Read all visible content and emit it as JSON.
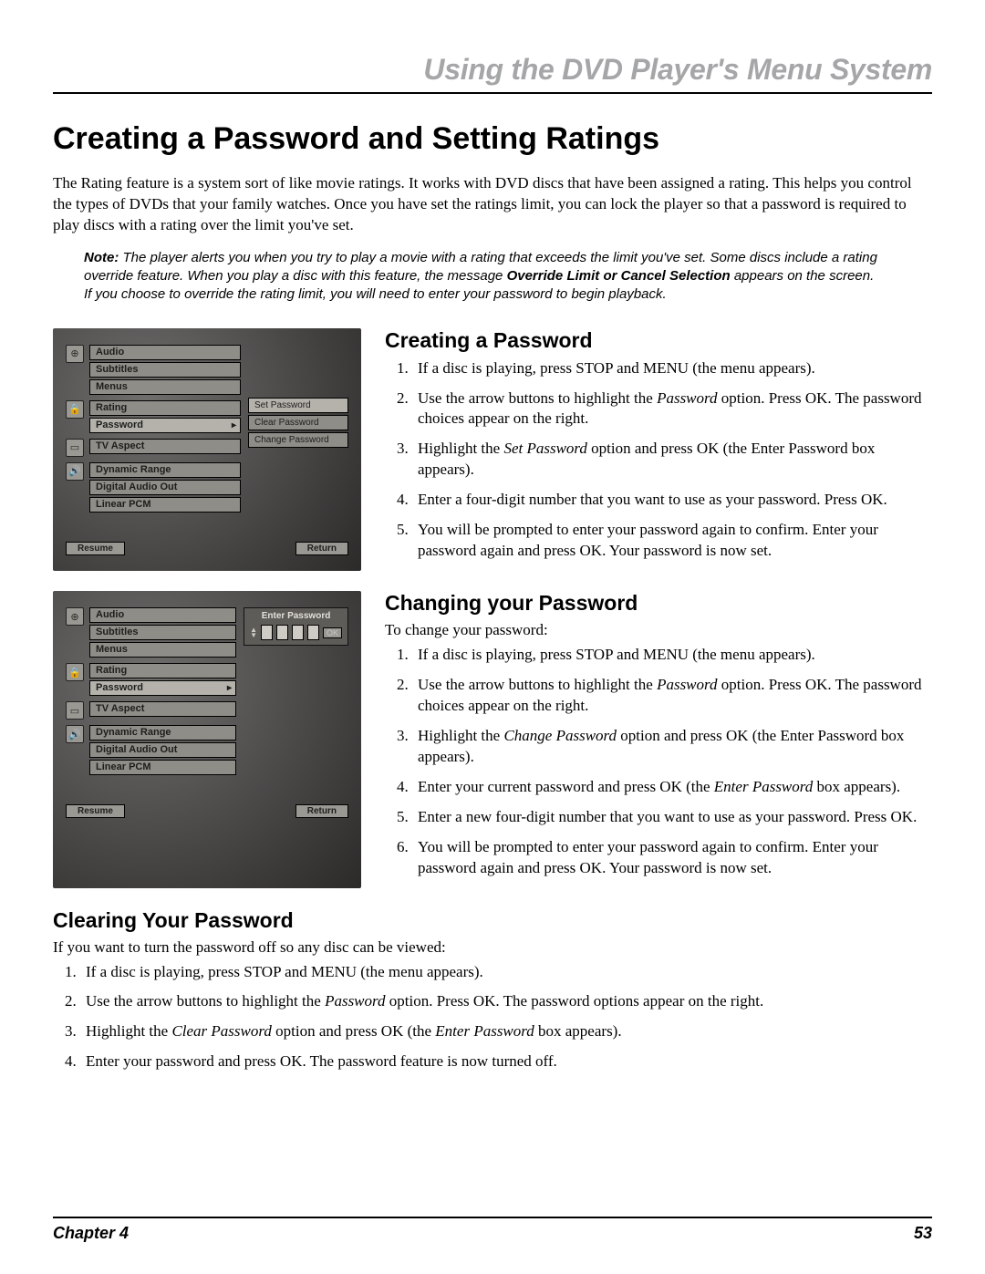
{
  "running_head": "Using the DVD Player's Menu System",
  "h1": "Creating a Password and Setting Ratings",
  "intro": "The Rating feature is a system sort of like movie ratings. It works with DVD discs that have been assigned a rating. This helps you control the types of DVDs that your family watches. Once you have set the ratings limit, you can lock the player so that a password is required to play discs with a rating over the limit you've set.",
  "note_label": "Note:",
  "note_body_a": " The player alerts you when you try to play a movie with a rating that exceeds the limit you've set. Some discs include a rating override feature. When you play a disc with this feature, the message ",
  "note_bold": "Override Limit or Cancel Selection",
  "note_body_b": " appears on the screen. If you choose to override the rating limit, you will need to enter your password to begin playback.",
  "shot1": {
    "groups": [
      {
        "icon": "⊕",
        "items": [
          "Audio",
          "Subtitles",
          "Menus"
        ]
      },
      {
        "icon": "🔒",
        "items": [
          "Rating",
          "Password"
        ],
        "selected": 1
      },
      {
        "icon": "▭",
        "items": [
          "TV Aspect"
        ]
      },
      {
        "icon": "🔊",
        "items": [
          "Dynamic Range",
          "Digital Audio Out",
          "Linear PCM"
        ]
      }
    ],
    "side": [
      "Set Password",
      "Clear Password",
      "Change Password"
    ],
    "side_sel": 0,
    "resume": "Resume",
    "return": "Return"
  },
  "shot2": {
    "groups": [
      {
        "icon": "⊕",
        "items": [
          "Audio",
          "Subtitles",
          "Menus"
        ]
      },
      {
        "icon": "🔒",
        "items": [
          "Rating",
          "Password"
        ],
        "selected": 1
      },
      {
        "icon": "▭",
        "items": [
          "TV Aspect"
        ]
      },
      {
        "icon": "🔊",
        "items": [
          "Dynamic Range",
          "Digital Audio Out",
          "Linear PCM"
        ]
      }
    ],
    "enter_label": "Enter Password",
    "ok": "OK",
    "resume": "Resume",
    "return": "Return"
  },
  "sec1": {
    "title": "Creating a Password",
    "items": [
      "If a disc is playing, press STOP and MENU (the menu appears).",
      "Use the arrow buttons to highlight the <em>Password</em> option. Press OK. The password choices appear on the right.",
      "Highlight the <em>Set Password</em> option and press OK (the Enter Password box appears).",
      "Enter a four-digit number that you want to use as your password. Press OK.",
      "You will be prompted to enter your password again to confirm. Enter your password again and press OK. Your password is now set."
    ]
  },
  "sec2": {
    "title": "Changing your Password",
    "lead": "To change your password:",
    "items": [
      "If a disc is playing, press STOP and MENU (the menu appears).",
      "Use the arrow buttons to highlight the <em>Password</em> option. Press OK. The password choices appear on the right.",
      "Highlight the <em>Change Password</em> option and press OK (the Enter Password box appears).",
      "Enter your current password and press OK (the <em>Enter Password</em> box appears).",
      "Enter a new four-digit number that you want to use as your password. Press OK.",
      "You will be prompted to enter your password again to confirm. Enter your password again and press OK. Your password is now set."
    ]
  },
  "sec3": {
    "title": "Clearing Your Password",
    "lead": "If you want to turn the password off so any disc can be viewed:",
    "items": [
      "If a disc is playing, press STOP and MENU (the menu appears).",
      "Use the arrow buttons to highlight the <em>Password</em> option. Press OK. The password options appear on the right.",
      "Highlight the <em>Clear Password</em> option and press OK (the <em>Enter Password</em> box appears).",
      "Enter your password and press OK. The password feature is now turned off."
    ]
  },
  "footer": {
    "chapter": "Chapter 4",
    "page": "53"
  }
}
